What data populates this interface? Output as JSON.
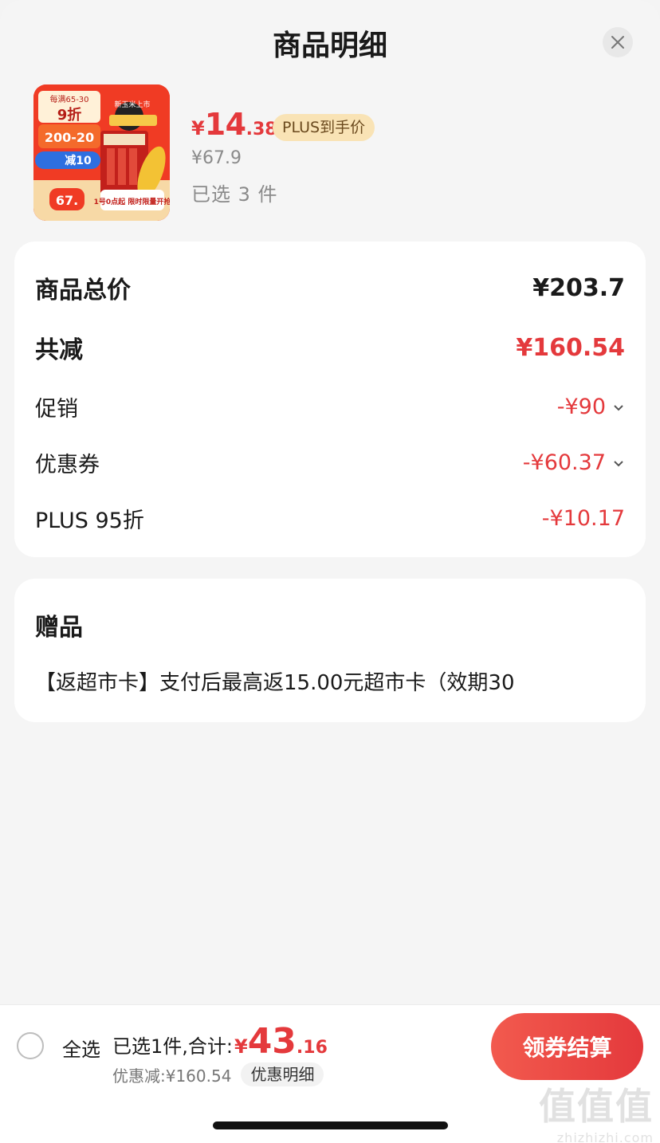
{
  "header": {
    "title": "商品明细"
  },
  "product": {
    "price_currency": "¥",
    "price_integer": "14",
    "price_decimal": ".38",
    "plus_tag": "PLUS到手价",
    "original_price": "¥67.9",
    "selected_count": "已选 3 件",
    "image_badge_top": "每满65-30",
    "image_badge_discount": "9折",
    "image_badge_deal": "200-20",
    "image_badge_cut": "减10",
    "image_badge_price": "67.",
    "image_banner": "新玉米上市",
    "image_slogan": "1号0点起 限时限量开抢"
  },
  "summary": {
    "total_label": "商品总价",
    "total_value": "¥203.7",
    "saved_label": "共减",
    "saved_value": "¥160.54",
    "promo_label": "促销",
    "promo_value": "-¥90",
    "coupon_label": "优惠券",
    "coupon_value": "-¥60.37",
    "plus_label": "PLUS 95折",
    "plus_value": "-¥10.17"
  },
  "gift": {
    "title": "赠品",
    "text": "【返超市卡】支付后最高返15.00元超市卡（效期30"
  },
  "bottom_bar": {
    "select_all": "全选",
    "summary_label": "已选1件,合计:",
    "total_currency": "¥",
    "total_integer": "43",
    "total_decimal": ".16",
    "discount_text": "优惠减:¥160.54",
    "detail_button": "优惠明细",
    "checkout_button": "领券结算"
  },
  "watermark": {
    "big": "值值值",
    "small": "zhizhizhi.com"
  },
  "colors": {
    "accent_red": "#e4393c",
    "plus_tag_bg": "#f9e3b5",
    "background": "#f5f5f5"
  }
}
